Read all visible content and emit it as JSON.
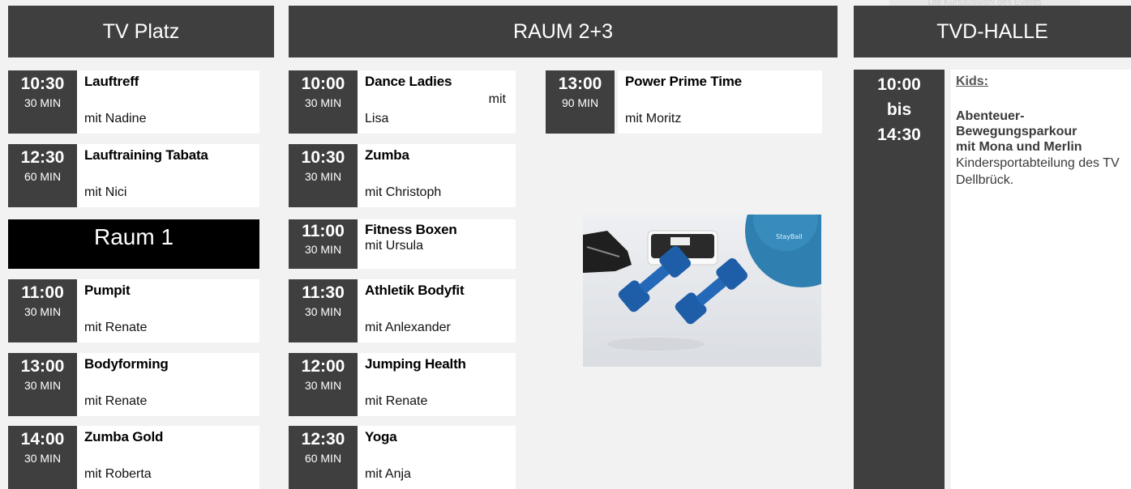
{
  "top_note": "Die Kursauswahl des Events",
  "headers": {
    "tv_platz": "TV Platz",
    "raum23": "RAUM 2+3",
    "tvd_halle": "TVD-HALLE"
  },
  "raum1_label": "Raum 1",
  "tv_platz": [
    {
      "time": "10:30",
      "duration": "30 MIN",
      "title": "Lauftreff",
      "instructor": "mit Nadine"
    },
    {
      "time": "12:30",
      "duration": "60 MIN",
      "title": "Lauftraining Tabata",
      "instructor": "mit Nici"
    }
  ],
  "raum1": [
    {
      "time": "11:00",
      "duration": "30 MIN",
      "title": "Pumpit",
      "instructor": "mit Renate"
    },
    {
      "time": "13:00",
      "duration": "30 MIN",
      "title": "Bodyforming",
      "instructor": "mit Renate"
    },
    {
      "time": "14:00",
      "duration": "30 MIN",
      "title": "Zumba Gold",
      "instructor": "mit Roberta"
    }
  ],
  "raum23": [
    {
      "time": "10:00",
      "duration": "30 MIN",
      "title": "Dance Ladies",
      "mit": "mit",
      "instructor": "Lisa"
    },
    {
      "time": "10:30",
      "duration": "30 MIN",
      "title": "Zumba",
      "instructor": "mit Christoph"
    },
    {
      "time": "11:00",
      "duration": "30 MIN",
      "title": "Fitness Boxen",
      "instructor": "mit Ursula"
    },
    {
      "time": "11:30",
      "duration": "30 MIN",
      "title": "Athletik Bodyfit",
      "instructor": "mit Anlexander"
    },
    {
      "time": "12:00",
      "duration": "30 MIN",
      "title": "Jumping Health",
      "instructor": "mit Renate"
    },
    {
      "time": "12:30",
      "duration": "60 MIN",
      "title": "Yoga",
      "instructor": "mit Anja"
    }
  ],
  "raum23_col2": [
    {
      "time": "13:00",
      "duration": "90 MIN",
      "title": "Power Prime Time",
      "instructor": "mit Moritz"
    }
  ],
  "photo_label": "StayBall",
  "tvd": {
    "time_from": "10:00",
    "bis": "bis",
    "time_to": "14:30",
    "kids": "Kids:",
    "desc_line1": "Abenteuer-",
    "desc_line2": "Bewegungsparkour",
    "desc_line3": "mit Mona und Merlin",
    "note": " Kindersportabteilung des TV Dellbrück."
  },
  "colors": {
    "dark": "#3f3f3f",
    "raum1_bg": "#000000",
    "page_bg": "#f2f2f2"
  }
}
